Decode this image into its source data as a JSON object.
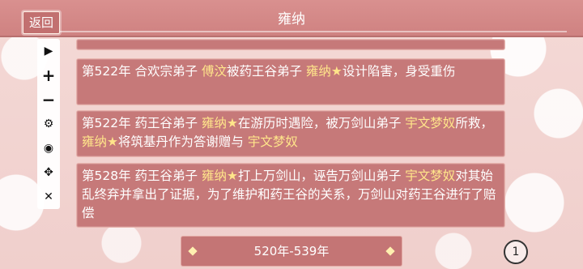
{
  "header": {
    "back_label": "返回",
    "title": "雍纳"
  },
  "toolbar": {
    "items": [
      {
        "icon": "play-icon",
        "glyph": "▶"
      },
      {
        "icon": "plus-icon",
        "glyph": "+"
      },
      {
        "icon": "minus-icon",
        "glyph": "−"
      },
      {
        "icon": "gear-icon",
        "glyph": "⚙"
      },
      {
        "icon": "eye-off-icon",
        "glyph": "◉"
      },
      {
        "icon": "move-icon",
        "glyph": "✥"
      },
      {
        "icon": "close-icon",
        "glyph": "✕"
      }
    ]
  },
  "events": [
    {
      "parts": [
        {
          "t": "第522年  合欢宗弟子 "
        },
        {
          "t": "傅汶",
          "hl": true
        },
        {
          "t": "被药王谷弟子 "
        },
        {
          "t": "雍纳★",
          "hl": true
        },
        {
          "t": "设计陷害，身受重伤"
        }
      ]
    },
    {
      "parts": [
        {
          "t": "第522年  药王谷弟子 "
        },
        {
          "t": "雍纳★",
          "hl": true
        },
        {
          "t": "在游历时遇险，被万剑山弟子 "
        },
        {
          "t": "宇文梦奴",
          "hl": true
        },
        {
          "t": "所救，"
        },
        {
          "t": "雍纳★",
          "hl": true
        },
        {
          "t": "将筑基丹作为答谢赠与 "
        },
        {
          "t": "宇文梦奴",
          "hl": true
        }
      ]
    },
    {
      "parts": [
        {
          "t": "第528年  药王谷弟子 "
        },
        {
          "t": "雍纳★",
          "hl": true
        },
        {
          "t": "打上万剑山，诬告万剑山弟子 "
        },
        {
          "t": "宇文梦奴",
          "hl": true
        },
        {
          "t": "对其始乱终弃并拿出了证据，为了维护和药王谷的关系，万剑山对药王谷进行了赔偿"
        }
      ]
    }
  ],
  "pager": {
    "range": "520年-539年"
  },
  "locate": {
    "number": "1"
  },
  "colors": {
    "card": "#c67979",
    "highlight": "#ffe58a",
    "header": "#d9908f"
  }
}
